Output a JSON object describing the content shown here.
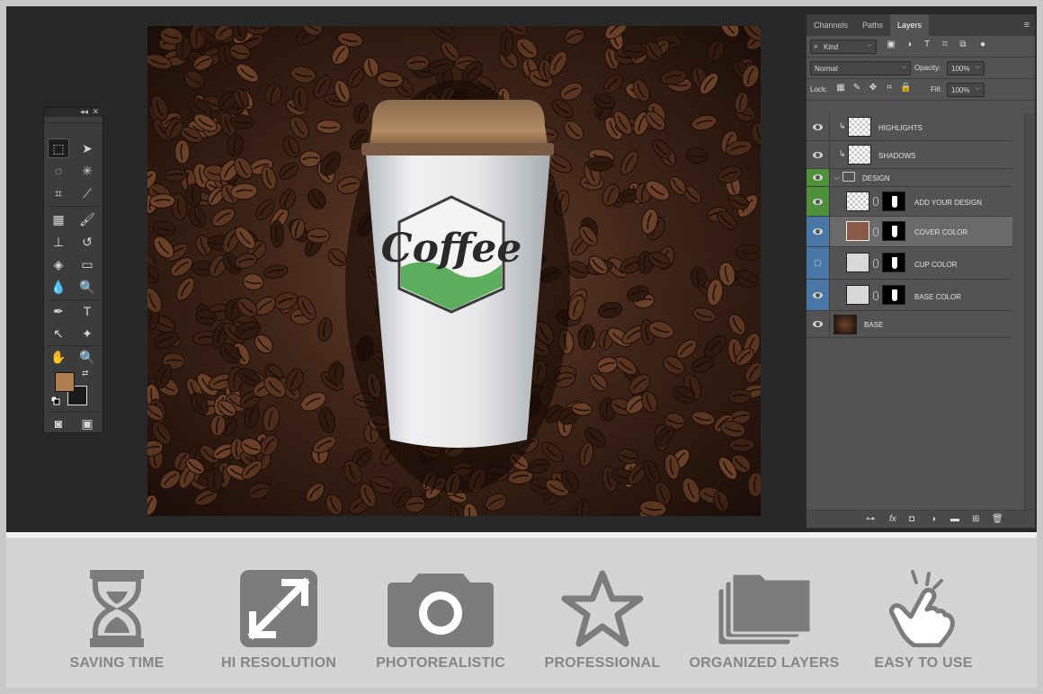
{
  "layers_panel": {
    "tabs": [
      {
        "label": "Channels",
        "active": false
      },
      {
        "label": "Paths",
        "active": false
      },
      {
        "label": "Layers",
        "active": true
      }
    ],
    "filter_kind": "Kind",
    "blend_mode": "Normal",
    "opacity_label": "Opacity:",
    "opacity_value": "100%",
    "lock_label": "Lock:",
    "fill_label": "Fill:",
    "fill_value": "100%",
    "layers": [
      {
        "name": "HIGHLIGHTS",
        "visible": true,
        "clipped": true
      },
      {
        "name": "SHADOWS",
        "visible": true,
        "clipped": true
      },
      {
        "name": "DESIGN",
        "visible": true,
        "group": true,
        "label_color": "#4e8f3a"
      },
      {
        "name": "ADD YOUR DESIGN",
        "visible": true,
        "label_color": "#4e8f3a"
      },
      {
        "name": "COVER COLOR",
        "visible": true,
        "selected": true,
        "label_color": "#4a78a6",
        "fill_color": "#8a5a45"
      },
      {
        "name": "CUP COLOR",
        "visible": false,
        "label_color": "#4a78a6"
      },
      {
        "name": "BASE COLOR",
        "visible": true,
        "label_color": "#4a78a6"
      },
      {
        "name": "BASE",
        "visible": true
      }
    ]
  },
  "tools_panel": {
    "foreground_color": "#b07d51",
    "background_color": "#1a1a1a"
  },
  "canvas": {
    "cup_logo_text": "Coffee"
  },
  "features": [
    {
      "label": "SAVING TIME",
      "icon": "hourglass-icon"
    },
    {
      "label": "HI RESOLUTION",
      "icon": "expand-arrows-icon"
    },
    {
      "label": "PHOTOREALISTIC",
      "icon": "camera-icon"
    },
    {
      "label": "PROFESSIONAL",
      "icon": "star-icon"
    },
    {
      "label": "ORGANIZED LAYERS",
      "icon": "stacked-layers-icon"
    },
    {
      "label": "EASY TO USE",
      "icon": "tap-hand-icon"
    }
  ],
  "colors": {
    "feature_icon": "#7c7c7c",
    "feature_label": "#858585",
    "ps_panel": "#535353",
    "workspace": "#282828"
  }
}
